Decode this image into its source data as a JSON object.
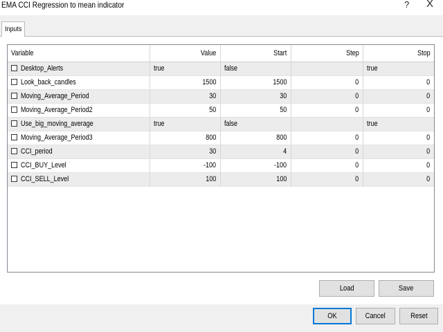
{
  "window": {
    "title": "EMA CCI Regression to mean indicator",
    "help_glyph": "?",
    "close_glyph": "X"
  },
  "tabs": [
    {
      "label": "Inputs"
    }
  ],
  "table": {
    "headers": {
      "variable": "Variable",
      "value": "Value",
      "start": "Start",
      "step": "Step",
      "stop": "Stop"
    },
    "rows": [
      {
        "variable": "Desktop_Alerts",
        "value": "true",
        "start": "false",
        "step": "",
        "stop": "true",
        "numeric": false
      },
      {
        "variable": "Look_back_candles",
        "value": "1500",
        "start": "1500",
        "step": "0",
        "stop": "0",
        "numeric": true
      },
      {
        "variable": "Moving_Average_Period",
        "value": "30",
        "start": "30",
        "step": "0",
        "stop": "0",
        "numeric": true
      },
      {
        "variable": "Moving_Average_Period2",
        "value": "50",
        "start": "50",
        "step": "0",
        "stop": "0",
        "numeric": true
      },
      {
        "variable": "Use_big_moving_average",
        "value": "true",
        "start": "false",
        "step": "",
        "stop": "true",
        "numeric": false
      },
      {
        "variable": "Moving_Average_Period3",
        "value": "800",
        "start": "800",
        "step": "0",
        "stop": "0",
        "numeric": true
      },
      {
        "variable": "CCI_period",
        "value": "30",
        "start": "4",
        "step": "0",
        "stop": "0",
        "numeric": true
      },
      {
        "variable": "CCI_BUY_Level",
        "value": "-100",
        "start": "-100",
        "step": "0",
        "stop": "0",
        "numeric": true
      },
      {
        "variable": "CCI_SELL_Level",
        "value": "100",
        "start": "100",
        "step": "0",
        "stop": "0",
        "numeric": true
      }
    ]
  },
  "buttons": {
    "load": "Load",
    "save": "Save",
    "ok": "OK",
    "cancel": "Cancel",
    "reset": "Reset"
  }
}
